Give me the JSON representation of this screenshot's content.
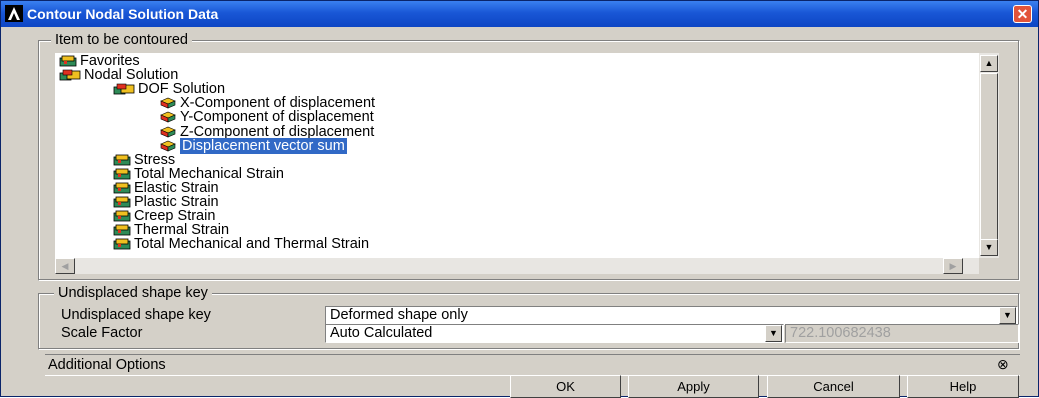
{
  "window": {
    "title": "Contour Nodal Solution Data",
    "close_glyph": "✕"
  },
  "item_group": {
    "legend": "Item to be contoured",
    "tree": [
      {
        "label": "Favorites",
        "icon": "folder-icon",
        "level": 0
      },
      {
        "label": "Nodal Solution",
        "icon": "folder-open-icon",
        "level": 0
      },
      {
        "label": "DOF Solution",
        "icon": "folder-open-icon",
        "level": 1
      },
      {
        "label": "X-Component of displacement",
        "icon": "cube-icon",
        "level": 2
      },
      {
        "label": "Y-Component of displacement",
        "icon": "cube-icon",
        "level": 2
      },
      {
        "label": "Z-Component of displacement",
        "icon": "cube-icon",
        "level": 2
      },
      {
        "label": "Displacement vector sum",
        "icon": "cube-icon",
        "level": 2,
        "selected": true
      },
      {
        "label": "Stress",
        "icon": "folder-icon",
        "level": 1
      },
      {
        "label": "Total Mechanical Strain",
        "icon": "folder-icon",
        "level": 1
      },
      {
        "label": "Elastic Strain",
        "icon": "folder-icon",
        "level": 1
      },
      {
        "label": "Plastic Strain",
        "icon": "folder-icon",
        "level": 1
      },
      {
        "label": "Creep Strain",
        "icon": "folder-icon",
        "level": 1
      },
      {
        "label": "Thermal Strain",
        "icon": "folder-icon",
        "level": 1
      },
      {
        "label": "Total Mechanical and Thermal Strain",
        "icon": "folder-icon",
        "level": 1
      }
    ]
  },
  "undisplaced_group": {
    "legend": "Undisplaced shape key",
    "key_label": "Undisplaced shape key",
    "key_value": "Deformed shape only",
    "scale_label": "Scale Factor",
    "scale_value": "Auto Calculated",
    "scale_number": "722.100682438"
  },
  "additional_options": {
    "label": "Additional Options",
    "expand_glyph": "⊗"
  },
  "buttons": {
    "ok": "OK",
    "apply": "Apply",
    "cancel": "Cancel",
    "help": "Help"
  },
  "colors": {
    "title_bar": "#1957d6",
    "dialog_bg": "#d4d0c8",
    "selection": "#3169c6",
    "close_button": "#e2543a"
  }
}
